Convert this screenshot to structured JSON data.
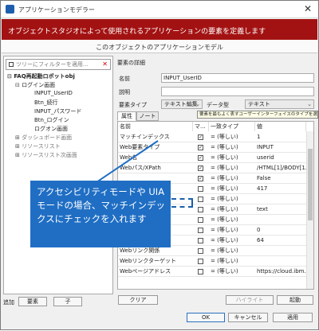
{
  "window": {
    "title": "アプリケーションモデラー",
    "close_glyph": "✕"
  },
  "banner": {
    "text": "オブジェクトスタジオによって使用されるアプリケーションの要素を定義します"
  },
  "subheader": {
    "text": "このオブジェクトのアプリケーションモデル"
  },
  "tree": {
    "filter_placeholder": "ツリーにフィルターを適用...",
    "items": [
      {
        "label": "FAQ再起動ロボットobj",
        "expander": "⊟"
      },
      {
        "label": "ログイン画面",
        "expander": "⊟"
      },
      {
        "label": "INPUT_UserID",
        "expander": ""
      },
      {
        "label": "Btn_続行",
        "expander": ""
      },
      {
        "label": "INPUT_パスワード",
        "expander": ""
      },
      {
        "label": "Btn_ログイン",
        "expander": ""
      },
      {
        "label": "ログオン画面",
        "expander": ""
      },
      {
        "label": "ダッシュボード画面",
        "expander": "⊞"
      },
      {
        "label": "リソースリスト",
        "expander": "⊞"
      },
      {
        "label": "リソースリスト次画面",
        "expander": "⊞"
      }
    ],
    "add_label": "追加",
    "add_element_button": "要素",
    "add_child_button": "子"
  },
  "details": {
    "section_label": "要素の詳細",
    "name_label": "名前",
    "name_value": "INPUT_UserID",
    "description_label": "説明",
    "description_value": "",
    "element_type_label": "要素タイプ",
    "element_type_value": "テキスト編集",
    "data_type_label": "データ型",
    "data_type_value": "テキスト",
    "tooltip": "要素を最もよく表すユーザーインターフェイスのタイプを選",
    "tabs": [
      "属性",
      "ノート"
    ]
  },
  "grid": {
    "headers": [
      "名前",
      "マ...",
      "一致タイプ",
      "値"
    ],
    "rows": [
      {
        "name": "マッチインデックス",
        "checked": true,
        "match": "= (等しい)",
        "value": "1"
      },
      {
        "name": "Web要素タイプ",
        "checked": true,
        "match": "= (等しい)",
        "value": "INPUT"
      },
      {
        "name": "Web名",
        "checked": true,
        "match": "= (等しい)",
        "value": "userid"
      },
      {
        "name": "Webパス/XPath",
        "checked": true,
        "match": "= (等しい)",
        "value": "/HTML[1]/BODY[1..."
      },
      {
        "name": "",
        "checked": true,
        "match": "= (等しい)",
        "value": "False"
      },
      {
        "name": "",
        "checked": false,
        "match": "= (等しい)",
        "value": "417"
      },
      {
        "name": "",
        "checked": false,
        "match": "= (等しい)",
        "value": ""
      },
      {
        "name": "",
        "checked": false,
        "match": "= (等しい)",
        "value": "text"
      },
      {
        "name": "",
        "checked": false,
        "match": "= (等しい)",
        "value": ""
      },
      {
        "name": "",
        "checked": false,
        "match": "= (等しい)",
        "value": "0"
      },
      {
        "name": "",
        "checked": false,
        "match": "= (等しい)",
        "value": "64"
      },
      {
        "name": "Webリンク関係",
        "checked": false,
        "match": "= (等しい)",
        "value": ""
      },
      {
        "name": "Webリンクターゲット",
        "checked": false,
        "match": "= (等しい)",
        "value": ""
      },
      {
        "name": "Webページアドレス",
        "checked": false,
        "match": "= (等しい)",
        "value": "https://cloud.ibm..."
      }
    ]
  },
  "actions": {
    "clear": "クリア",
    "highlight": "ハイライト",
    "launch": "起動",
    "ok": "OK",
    "cancel": "キャンセル",
    "apply": "適用"
  },
  "callout": {
    "text": "アクセシビリティモードや UIA モードの場合、マッチインデックスにチェックを入れます"
  },
  "colors": {
    "banner": "#a31212",
    "callout": "#1f6ec4",
    "highlight_border": "#1b5ea8"
  }
}
